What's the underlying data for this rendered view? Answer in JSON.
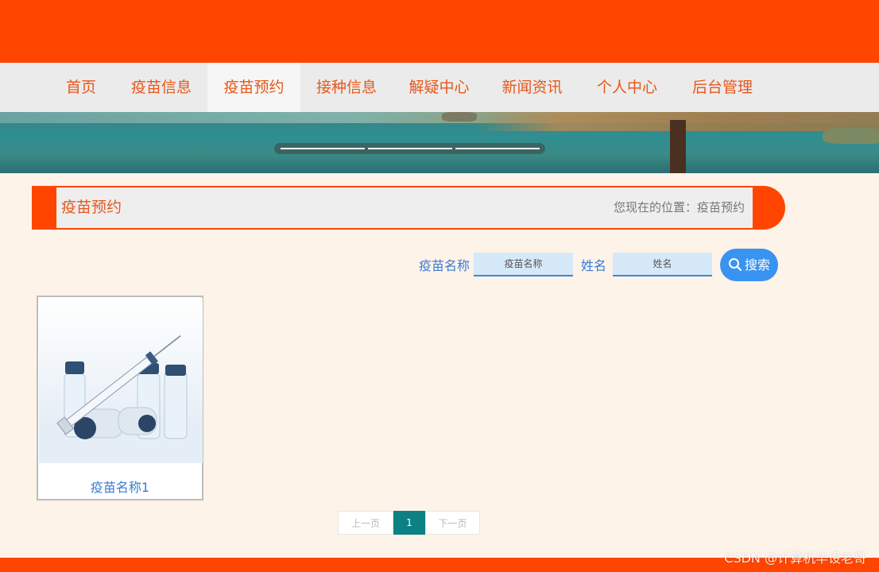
{
  "nav": {
    "items": [
      {
        "label": "首页"
      },
      {
        "label": "疫苗信息"
      },
      {
        "label": "疫苗预约"
      },
      {
        "label": "接种信息"
      },
      {
        "label": "解疑中心"
      },
      {
        "label": "新闻资讯"
      },
      {
        "label": "个人中心"
      },
      {
        "label": "后台管理"
      }
    ],
    "active": "疫苗预约"
  },
  "section": {
    "title": "疫苗预约",
    "breadcrumb": "您现在的位置：疫苗预约"
  },
  "search": {
    "field1_label": "疫苗名称",
    "field1_placeholder": "疫苗名称",
    "field2_label": "姓名",
    "field2_placeholder": "姓名",
    "button_label": "搜索",
    "button_icon": "search-icon"
  },
  "cards": [
    {
      "title": "疫苗名称1"
    }
  ],
  "pagination": {
    "prev": "上一页",
    "current": "1",
    "next": "下一页"
  },
  "watermark": "CSDN @计算机毕设老哥",
  "colors": {
    "brand": "#ff4500",
    "link": "#3a7bd5",
    "page_active": "#0c8082",
    "search_button": "#3993f0"
  }
}
